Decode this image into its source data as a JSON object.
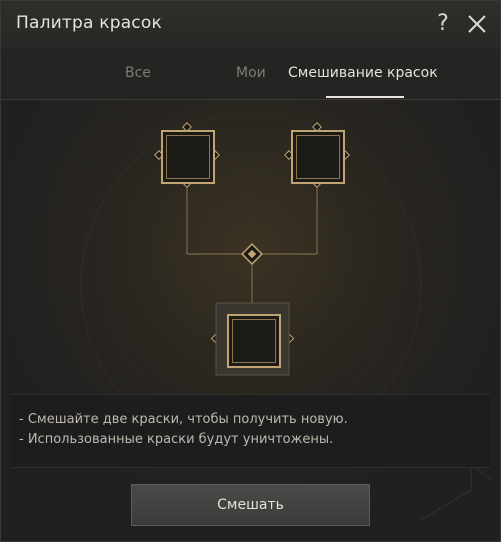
{
  "window": {
    "title": "Палитра красок"
  },
  "tabs": [
    {
      "label": "Все",
      "active": false
    },
    {
      "label": "Мои",
      "active": false
    },
    {
      "label": "Смешивание красок",
      "active": true
    }
  ],
  "info": {
    "lines": [
      "- Смешайте две краски, чтобы получить новую.",
      "- Использованные краски будут уничтожены."
    ]
  },
  "actions": {
    "mix_label": "Смешать"
  },
  "colors": {
    "gold_accent": "#bfa474",
    "active_tab": "#e6e2d8",
    "inactive_tab": "#7d7a72"
  },
  "icons": {
    "help": "help-icon",
    "close": "close-icon"
  }
}
